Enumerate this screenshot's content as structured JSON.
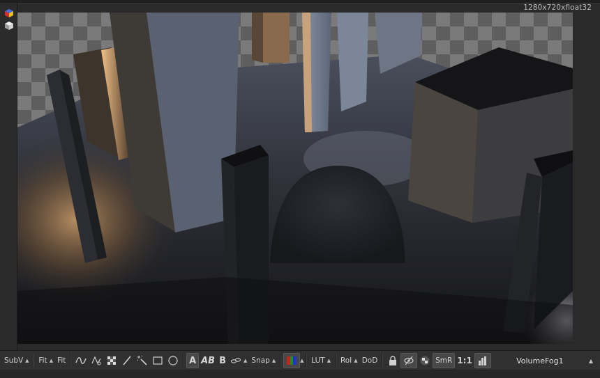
{
  "viewer": {
    "resolution_info": "1280x720xfloat32",
    "view_name": "VolumeFog1"
  },
  "left_toolbar": {
    "icons": [
      "color-cube-icon",
      "white-cube-icon"
    ]
  },
  "toolbar": {
    "subv_label": "SubV",
    "fit_label_1": "Fit",
    "fit_label_2": "Fit",
    "spline_icon": "spline-icon",
    "polyline_icon": "polyline-icon",
    "checker_icon": "checker-icon",
    "paint_icon": "brush-icon",
    "magic_wand_icon": "magic-wand-icon",
    "rectangle_icon": "rectangle-icon",
    "ellipse_icon": "ellipse-icon",
    "a_label": "A",
    "ab_label": "AB",
    "b_label": "B",
    "link_icon": "link-icon",
    "snap_label": "Snap",
    "colors_icon": "rgb-channels-icon",
    "lut_label": "LUT",
    "roi_label": "RoI",
    "dod_label": "DoD",
    "lock_icon": "lock-icon",
    "hide_icon": "eye-slash-icon",
    "checker2_icon": "checker-icon",
    "smr_label": "SmR",
    "one_to_one_label": "1:1",
    "histogram_icon": "histogram-icon",
    "accent_red": "#c0281e",
    "accent_green": "#1e8c28",
    "accent_blue": "#2234c0"
  }
}
